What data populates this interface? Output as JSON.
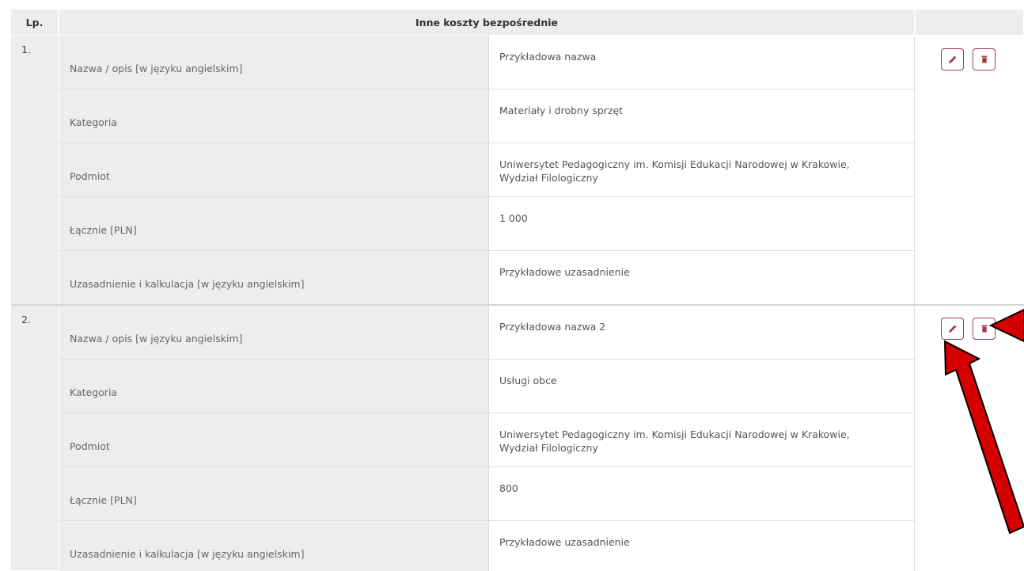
{
  "table": {
    "col_lp": "Lp.",
    "col_main": "Inne koszty bezpośrednie",
    "rows": [
      {
        "lp": "1.",
        "fields": [
          {
            "label": "Nazwa / opis [w języku angielskim]",
            "value": "Przykładowa nazwa"
          },
          {
            "label": "Kategoria",
            "value": "Materiały i drobny sprzęt"
          },
          {
            "label": "Podmiot",
            "value": "Uniwersytet Pedagogiczny im. Komisji Edukacji Narodowej w Krakowie, Wydział Filologiczny"
          },
          {
            "label": "Łącznie [PLN]",
            "value": "1 000"
          },
          {
            "label": "Uzasadnienie i kalkulacja [w języku angielskim]",
            "value": "Przykładowe uzasadnienie"
          }
        ]
      },
      {
        "lp": "2.",
        "fields": [
          {
            "label": "Nazwa / opis [w języku angielskim]",
            "value": "Przykładowa nazwa 2"
          },
          {
            "label": "Kategoria",
            "value": "Usługi obce"
          },
          {
            "label": "Podmiot",
            "value": "Uniwersytet Pedagogiczny im. Komisji Edukacji Narodowej w Krakowie, Wydział Filologiczny"
          },
          {
            "label": "Łącznie [PLN]",
            "value": "800"
          },
          {
            "label": "Uzasadnienie i kalkulacja [w języku angielskim]",
            "value": "Przykładowe uzasadnienie"
          }
        ]
      }
    ]
  },
  "icons": {
    "edit": "pencil-icon",
    "delete": "trash-icon"
  },
  "colors": {
    "accent": "#a33a4d",
    "header_bg": "#ededed",
    "arrow": "#d40000"
  }
}
